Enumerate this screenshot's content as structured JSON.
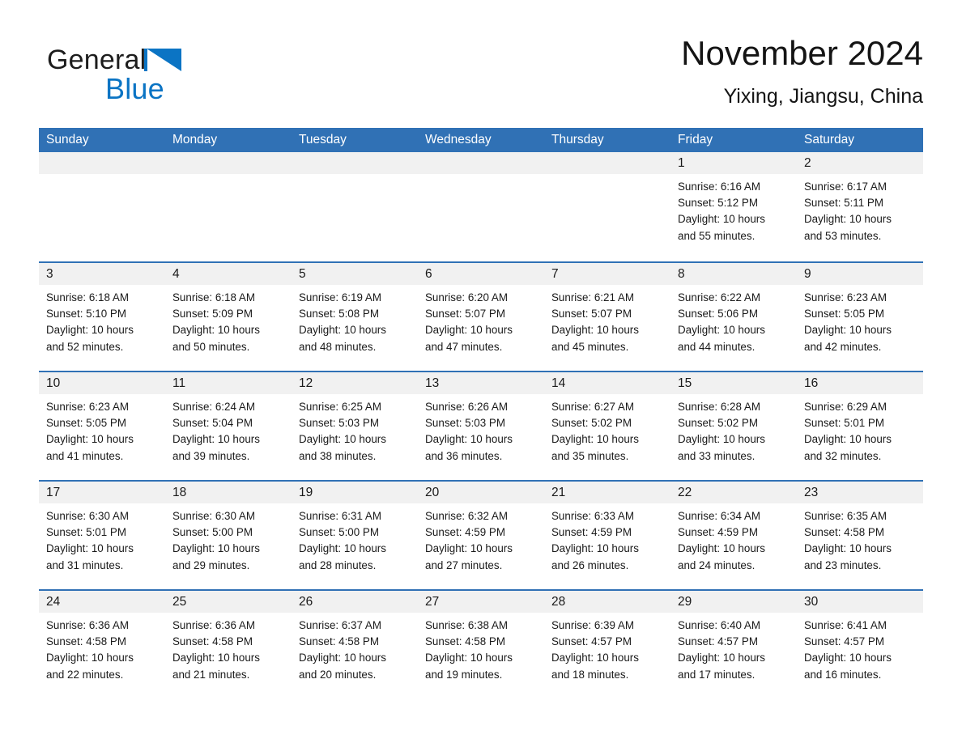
{
  "brand": {
    "name_part1": "General",
    "name_part2": "Blue",
    "triangle_color": "#0b74c4",
    "text_color": "#1d1d1d"
  },
  "header": {
    "title": "November 2024",
    "subtitle": "Yixing, Jiangsu, China"
  },
  "theme": {
    "header_blue": "#3071b5",
    "daynum_strip": "#f1f1f1",
    "text": "#1a1a1a"
  },
  "calendar": {
    "day_headers": [
      "Sunday",
      "Monday",
      "Tuesday",
      "Wednesday",
      "Thursday",
      "Friday",
      "Saturday"
    ],
    "weeks": [
      [
        {
          "day": "",
          "empty": true
        },
        {
          "day": "",
          "empty": true
        },
        {
          "day": "",
          "empty": true
        },
        {
          "day": "",
          "empty": true
        },
        {
          "day": "",
          "empty": true
        },
        {
          "day": "1",
          "sunrise": "Sunrise: 6:16 AM",
          "sunset": "Sunset: 5:12 PM",
          "daylight_line1": "Daylight: 10 hours",
          "daylight_line2": "and 55 minutes."
        },
        {
          "day": "2",
          "sunrise": "Sunrise: 6:17 AM",
          "sunset": "Sunset: 5:11 PM",
          "daylight_line1": "Daylight: 10 hours",
          "daylight_line2": "and 53 minutes."
        }
      ],
      [
        {
          "day": "3",
          "sunrise": "Sunrise: 6:18 AM",
          "sunset": "Sunset: 5:10 PM",
          "daylight_line1": "Daylight: 10 hours",
          "daylight_line2": "and 52 minutes."
        },
        {
          "day": "4",
          "sunrise": "Sunrise: 6:18 AM",
          "sunset": "Sunset: 5:09 PM",
          "daylight_line1": "Daylight: 10 hours",
          "daylight_line2": "and 50 minutes."
        },
        {
          "day": "5",
          "sunrise": "Sunrise: 6:19 AM",
          "sunset": "Sunset: 5:08 PM",
          "daylight_line1": "Daylight: 10 hours",
          "daylight_line2": "and 48 minutes."
        },
        {
          "day": "6",
          "sunrise": "Sunrise: 6:20 AM",
          "sunset": "Sunset: 5:07 PM",
          "daylight_line1": "Daylight: 10 hours",
          "daylight_line2": "and 47 minutes."
        },
        {
          "day": "7",
          "sunrise": "Sunrise: 6:21 AM",
          "sunset": "Sunset: 5:07 PM",
          "daylight_line1": "Daylight: 10 hours",
          "daylight_line2": "and 45 minutes."
        },
        {
          "day": "8",
          "sunrise": "Sunrise: 6:22 AM",
          "sunset": "Sunset: 5:06 PM",
          "daylight_line1": "Daylight: 10 hours",
          "daylight_line2": "and 44 minutes."
        },
        {
          "day": "9",
          "sunrise": "Sunrise: 6:23 AM",
          "sunset": "Sunset: 5:05 PM",
          "daylight_line1": "Daylight: 10 hours",
          "daylight_line2": "and 42 minutes."
        }
      ],
      [
        {
          "day": "10",
          "sunrise": "Sunrise: 6:23 AM",
          "sunset": "Sunset: 5:05 PM",
          "daylight_line1": "Daylight: 10 hours",
          "daylight_line2": "and 41 minutes."
        },
        {
          "day": "11",
          "sunrise": "Sunrise: 6:24 AM",
          "sunset": "Sunset: 5:04 PM",
          "daylight_line1": "Daylight: 10 hours",
          "daylight_line2": "and 39 minutes."
        },
        {
          "day": "12",
          "sunrise": "Sunrise: 6:25 AM",
          "sunset": "Sunset: 5:03 PM",
          "daylight_line1": "Daylight: 10 hours",
          "daylight_line2": "and 38 minutes."
        },
        {
          "day": "13",
          "sunrise": "Sunrise: 6:26 AM",
          "sunset": "Sunset: 5:03 PM",
          "daylight_line1": "Daylight: 10 hours",
          "daylight_line2": "and 36 minutes."
        },
        {
          "day": "14",
          "sunrise": "Sunrise: 6:27 AM",
          "sunset": "Sunset: 5:02 PM",
          "daylight_line1": "Daylight: 10 hours",
          "daylight_line2": "and 35 minutes."
        },
        {
          "day": "15",
          "sunrise": "Sunrise: 6:28 AM",
          "sunset": "Sunset: 5:02 PM",
          "daylight_line1": "Daylight: 10 hours",
          "daylight_line2": "and 33 minutes."
        },
        {
          "day": "16",
          "sunrise": "Sunrise: 6:29 AM",
          "sunset": "Sunset: 5:01 PM",
          "daylight_line1": "Daylight: 10 hours",
          "daylight_line2": "and 32 minutes."
        }
      ],
      [
        {
          "day": "17",
          "sunrise": "Sunrise: 6:30 AM",
          "sunset": "Sunset: 5:01 PM",
          "daylight_line1": "Daylight: 10 hours",
          "daylight_line2": "and 31 minutes."
        },
        {
          "day": "18",
          "sunrise": "Sunrise: 6:30 AM",
          "sunset": "Sunset: 5:00 PM",
          "daylight_line1": "Daylight: 10 hours",
          "daylight_line2": "and 29 minutes."
        },
        {
          "day": "19",
          "sunrise": "Sunrise: 6:31 AM",
          "sunset": "Sunset: 5:00 PM",
          "daylight_line1": "Daylight: 10 hours",
          "daylight_line2": "and 28 minutes."
        },
        {
          "day": "20",
          "sunrise": "Sunrise: 6:32 AM",
          "sunset": "Sunset: 4:59 PM",
          "daylight_line1": "Daylight: 10 hours",
          "daylight_line2": "and 27 minutes."
        },
        {
          "day": "21",
          "sunrise": "Sunrise: 6:33 AM",
          "sunset": "Sunset: 4:59 PM",
          "daylight_line1": "Daylight: 10 hours",
          "daylight_line2": "and 26 minutes."
        },
        {
          "day": "22",
          "sunrise": "Sunrise: 6:34 AM",
          "sunset": "Sunset: 4:59 PM",
          "daylight_line1": "Daylight: 10 hours",
          "daylight_line2": "and 24 minutes."
        },
        {
          "day": "23",
          "sunrise": "Sunrise: 6:35 AM",
          "sunset": "Sunset: 4:58 PM",
          "daylight_line1": "Daylight: 10 hours",
          "daylight_line2": "and 23 minutes."
        }
      ],
      [
        {
          "day": "24",
          "sunrise": "Sunrise: 6:36 AM",
          "sunset": "Sunset: 4:58 PM",
          "daylight_line1": "Daylight: 10 hours",
          "daylight_line2": "and 22 minutes."
        },
        {
          "day": "25",
          "sunrise": "Sunrise: 6:36 AM",
          "sunset": "Sunset: 4:58 PM",
          "daylight_line1": "Daylight: 10 hours",
          "daylight_line2": "and 21 minutes."
        },
        {
          "day": "26",
          "sunrise": "Sunrise: 6:37 AM",
          "sunset": "Sunset: 4:58 PM",
          "daylight_line1": "Daylight: 10 hours",
          "daylight_line2": "and 20 minutes."
        },
        {
          "day": "27",
          "sunrise": "Sunrise: 6:38 AM",
          "sunset": "Sunset: 4:58 PM",
          "daylight_line1": "Daylight: 10 hours",
          "daylight_line2": "and 19 minutes."
        },
        {
          "day": "28",
          "sunrise": "Sunrise: 6:39 AM",
          "sunset": "Sunset: 4:57 PM",
          "daylight_line1": "Daylight: 10 hours",
          "daylight_line2": "and 18 minutes."
        },
        {
          "day": "29",
          "sunrise": "Sunrise: 6:40 AM",
          "sunset": "Sunset: 4:57 PM",
          "daylight_line1": "Daylight: 10 hours",
          "daylight_line2": "and 17 minutes."
        },
        {
          "day": "30",
          "sunrise": "Sunrise: 6:41 AM",
          "sunset": "Sunset: 4:57 PM",
          "daylight_line1": "Daylight: 10 hours",
          "daylight_line2": "and 16 minutes."
        }
      ]
    ]
  }
}
